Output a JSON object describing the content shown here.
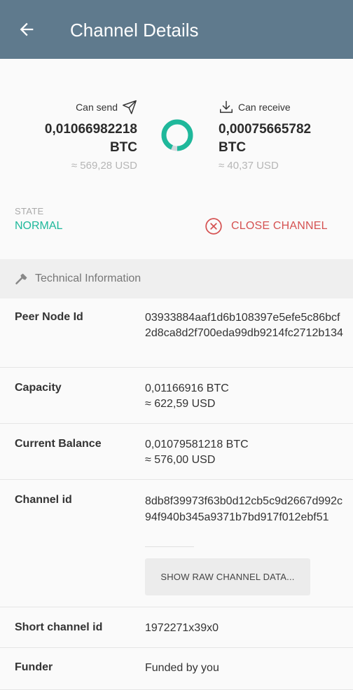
{
  "appbar": {
    "title": "Channel Details",
    "back_icon": "arrow-left-icon"
  },
  "summary": {
    "can_send_label": "Can send",
    "can_send_amount_line1": "0,01066982218",
    "can_send_amount_line2": "BTC",
    "can_send_fiat": "≈ 569,28 USD",
    "can_receive_label": "Can receive",
    "can_receive_amount_line1": "0,00075665782",
    "can_receive_amount_line2": "BTC",
    "can_receive_fiat": "≈ 40,37 USD",
    "donut_send_fraction": 0.934,
    "colors": {
      "send": "#1fb89b",
      "receive": "#cfd8dc"
    }
  },
  "state": {
    "label": "STATE",
    "value": "NORMAL",
    "close_label": "CLOSE CHANNEL"
  },
  "technical": {
    "title": "Technical Information",
    "peer_node_label": "Peer Node Id",
    "peer_node_value": "03933884aaf1d6b108397e5efe5c86bcf2d8ca8d2f700eda99db9214fc2712b134",
    "capacity_label": "Capacity",
    "capacity_btc": "0,01166916 BTC",
    "capacity_usd": "≈ 622,59 USD",
    "balance_label": "Current Balance",
    "balance_btc": "0,01079581218 BTC",
    "balance_usd": "≈ 576,00 USD",
    "channel_id_label": "Channel id",
    "channel_id_value": "8db8f39973f63b0d12cb5c9d2667d992c94f940b345a9371b7bd917f012ebf51",
    "raw_button": "SHOW RAW CHANNEL DATA...",
    "short_id_label": "Short channel id",
    "short_id_value": "1972271x39x0",
    "funder_label": "Funder",
    "funder_value": "Funded by you"
  }
}
